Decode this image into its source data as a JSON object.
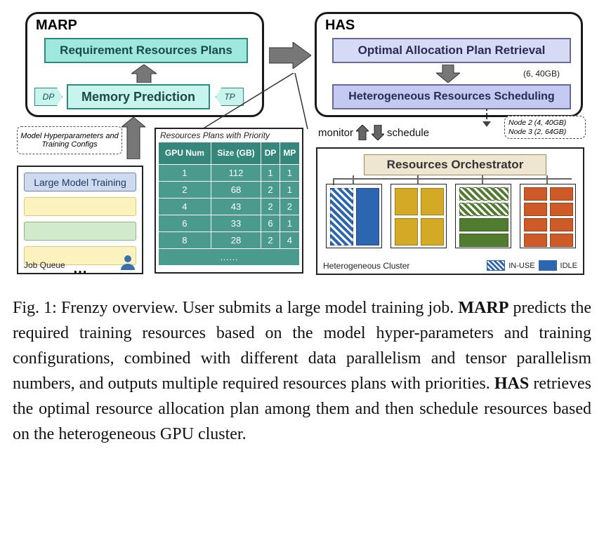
{
  "marp": {
    "title": "MARP",
    "requirement_label": "Requirement Resources Plans",
    "memory_label": "Memory Prediction",
    "dp_tag": "DP",
    "tp_tag": "TP"
  },
  "has": {
    "title": "HAS",
    "optimal_label": "Optimal Allocation Plan Retrieval",
    "schedule_label": "Heterogeneous Resources Scheduling",
    "tuple": "(6, 40GB)"
  },
  "annotation": {
    "text": "Model Hyperparameters and Training Configs"
  },
  "jobqueue": {
    "first_row": "Large Model Training",
    "footer": "Job Queue",
    "ellipsis": "⋯"
  },
  "resource_table": {
    "title": "Resources Plans with Priority",
    "cols": {
      "gpu": "GPU Num",
      "size": "Size (GB)",
      "dp": "DP",
      "mp": "MP"
    },
    "rows": [
      {
        "gpu": 1,
        "size": 112,
        "dp": 1,
        "mp": 1
      },
      {
        "gpu": 2,
        "size": 68,
        "dp": 2,
        "mp": 1
      },
      {
        "gpu": 4,
        "size": 43,
        "dp": 2,
        "mp": 2
      },
      {
        "gpu": 6,
        "size": 33,
        "dp": 6,
        "mp": 1
      },
      {
        "gpu": 8,
        "size": 28,
        "dp": 2,
        "mp": 4
      }
    ],
    "ellipsis": "……"
  },
  "mon_sched": {
    "monitor": "monitor",
    "schedule": "schedule"
  },
  "node_callout": {
    "line1": "Node 2 (4, 40GB)",
    "line2": "Node 3 (2, 64GB)"
  },
  "cluster": {
    "orch_label": "Resources  Orchestrator",
    "footer": "Heterogeneous Cluster",
    "legend_inuse": "IN-USE",
    "legend_idle": "IDLE"
  },
  "caption": {
    "prefix": "Fig. 1: Frenzy overview. User submits a large model training job. ",
    "marp": "MARP",
    "marp_text": " predicts the required training resources based on the model hyper-parameters and training configurations, combined with different data parallelism and tensor parallelism numbers, and outputs multiple required resources plans with priorities. ",
    "has": "HAS",
    "has_text": " retrieves the optimal resource allocation plan among them and then schedule resources based on the heterogeneous GPU cluster."
  }
}
